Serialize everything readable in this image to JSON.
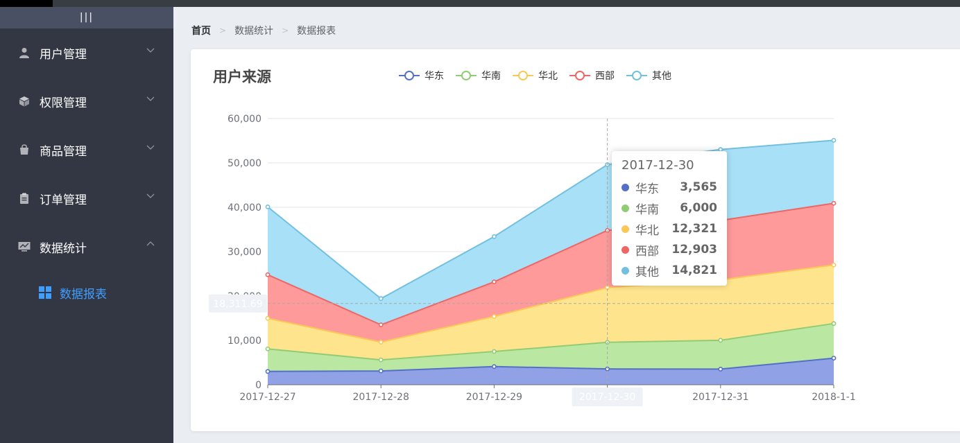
{
  "sidebar": {
    "collapse_label": "|||",
    "menus": [
      {
        "label": "用户管理",
        "icon": "user-icon",
        "expanded": false
      },
      {
        "label": "权限管理",
        "icon": "box-icon",
        "expanded": false
      },
      {
        "label": "商品管理",
        "icon": "bag-icon",
        "expanded": false
      },
      {
        "label": "订单管理",
        "icon": "clipboard-icon",
        "expanded": false
      },
      {
        "label": "数据统计",
        "icon": "chart-monitor-icon",
        "expanded": true
      }
    ],
    "submenu": {
      "label": "数据报表",
      "icon": "grid-icon",
      "color": "#409eff"
    }
  },
  "breadcrumb": [
    "首页",
    "数据统计",
    "数据报表"
  ],
  "chart_data": {
    "type": "area",
    "stacked": true,
    "title": "用户来源",
    "legend_position": "top",
    "categories": [
      "2017-12-27",
      "2017-12-28",
      "2017-12-29",
      "2017-12-30",
      "2017-12-31",
      "2018-1-1"
    ],
    "ylim": [
      0,
      60000
    ],
    "yticks": [
      "0",
      "10,000",
      "20,000",
      "30,000",
      "40,000",
      "50,000",
      "60,000"
    ],
    "series": [
      {
        "name": "华东",
        "color": "#5470c6",
        "fill": "#8ea0e4",
        "values": [
          2999,
          3111,
          4100,
          3565,
          3528,
          6000
        ]
      },
      {
        "name": "华南",
        "color": "#91cc75",
        "fill": "#b9e7a0",
        "values": [
          5090,
          2500,
          3400,
          6000,
          6500,
          7800
        ]
      },
      {
        "name": "华北",
        "color": "#fac858",
        "fill": "#ffe38c",
        "values": [
          6881,
          4000,
          7900,
          12321,
          13600,
          13200
        ]
      },
      {
        "name": "西部",
        "color": "#ee6666",
        "fill": "#ff9898",
        "values": [
          9827,
          3900,
          7800,
          12903,
          13400,
          13900
        ]
      },
      {
        "name": "其他",
        "color": "#73c0de",
        "fill": "#a6dff7",
        "values": [
          15300,
          5900,
          10200,
          14821,
          16000,
          14200
        ]
      }
    ],
    "axis_pointer": {
      "x_label": "2017-12-30",
      "y_label": "18,311.69",
      "y_value": 18311.69
    }
  },
  "tooltip": {
    "date": "2017-12-30",
    "rows": [
      {
        "name": "华东",
        "value": "3,565",
        "color": "#5470c6"
      },
      {
        "name": "华南",
        "value": "6,000",
        "color": "#91cc75"
      },
      {
        "name": "华北",
        "value": "12,321",
        "color": "#fac858"
      },
      {
        "name": "西部",
        "value": "12,903",
        "color": "#ee6666"
      },
      {
        "name": "其他",
        "value": "14,821",
        "color": "#73c0de"
      }
    ]
  }
}
